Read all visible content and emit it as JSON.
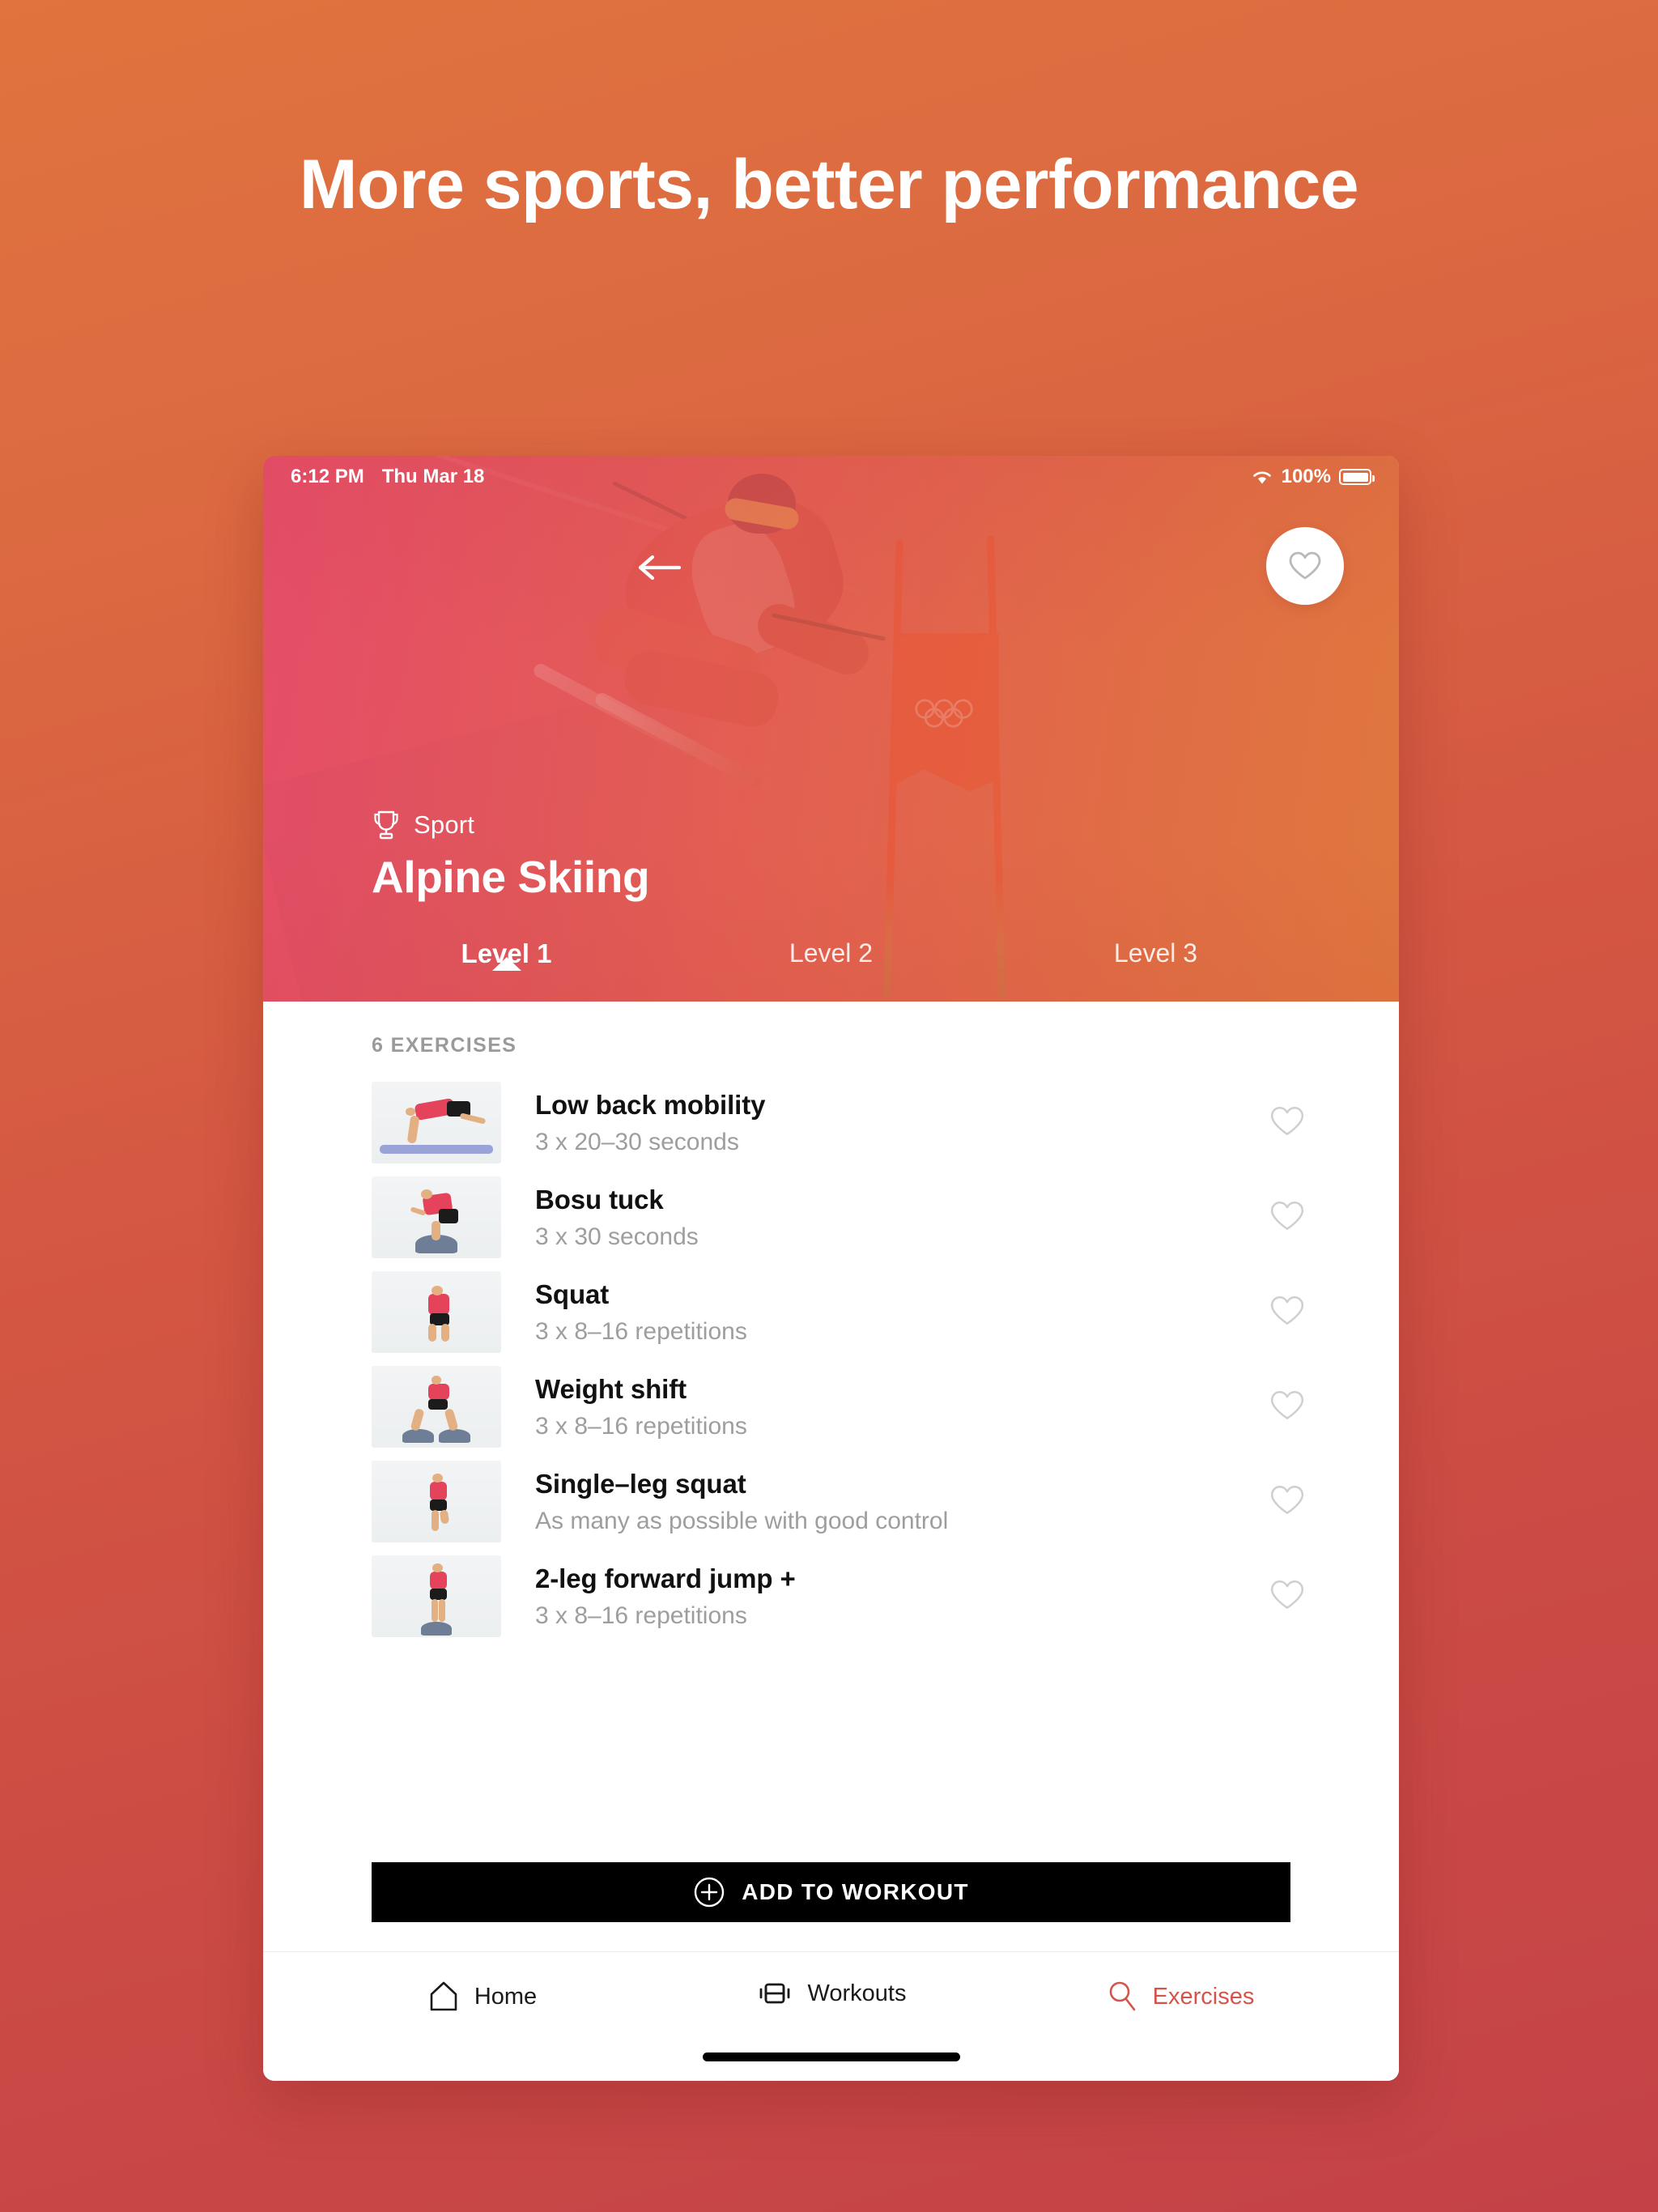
{
  "marketing": {
    "headline": "More sports, better performance"
  },
  "colors": {
    "bg_top": "#E0733E",
    "bg_bottom": "#C44247",
    "accent_active": "#D5544A",
    "cta_bg": "#000000",
    "hero_left": "#E8536B",
    "hero_right": "#DF7A3F"
  },
  "statusbar": {
    "time": "6:12 PM",
    "date": "Thu Mar 18",
    "battery_percent": "100%",
    "wifi_icon": "wifi-icon",
    "battery_icon": "battery-icon"
  },
  "hero": {
    "back_icon": "back-arrow-icon",
    "favorite_icon": "heart-outline-icon",
    "category_icon": "trophy-icon",
    "category_label": "Sport",
    "title": "Alpine Skiing",
    "photo_description": "alpine skier carving past an orange slalom gate"
  },
  "levels": {
    "active_index": 0,
    "items": [
      {
        "label": "Level 1"
      },
      {
        "label": "Level 2"
      },
      {
        "label": "Level 3"
      }
    ]
  },
  "exercises": {
    "count_label": "6 EXERCISES",
    "favorite_icon": "heart-outline-icon",
    "items": [
      {
        "name": "Low back mobility",
        "detail": "3 x 20–30 seconds"
      },
      {
        "name": "Bosu tuck",
        "detail": "3 x 30 seconds"
      },
      {
        "name": "Squat",
        "detail": "3 x 8–16 repetitions"
      },
      {
        "name": "Weight shift",
        "detail": "3 x 8–16 repetitions"
      },
      {
        "name": "Single–leg squat",
        "detail": "As many as possible with good control"
      },
      {
        "name": "2-leg forward jump +",
        "detail": "3 x 8–16 repetitions"
      }
    ]
  },
  "cta": {
    "label": "ADD TO WORKOUT",
    "icon": "plus-circle-icon"
  },
  "tabbar": {
    "active_index": 2,
    "items": [
      {
        "label": "Home",
        "icon": "home-icon"
      },
      {
        "label": "Workouts",
        "icon": "dumbbell-icon"
      },
      {
        "label": "Exercises",
        "icon": "search-icon"
      }
    ]
  }
}
